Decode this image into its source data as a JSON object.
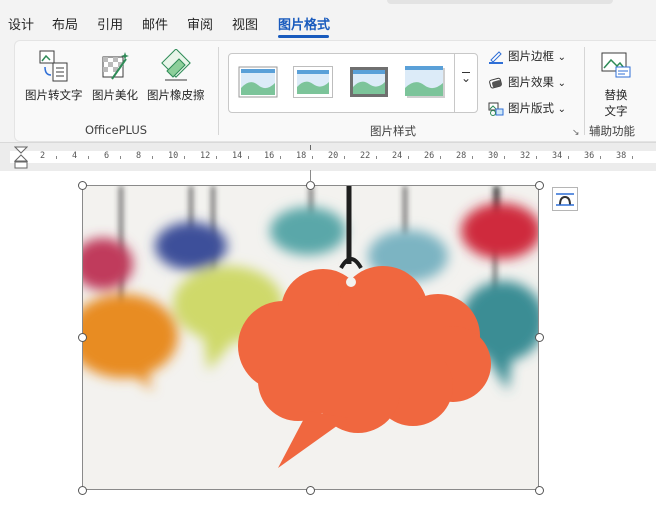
{
  "tabs": [
    {
      "label": "设计"
    },
    {
      "label": "布局"
    },
    {
      "label": "引用"
    },
    {
      "label": "邮件"
    },
    {
      "label": "审阅"
    },
    {
      "label": "视图"
    },
    {
      "label": "图片格式"
    }
  ],
  "ribbon": {
    "officeplus": {
      "group_label": "OfficePLUS",
      "buttons": [
        {
          "label": "图片转文字",
          "icon": "picture-to-text-icon"
        },
        {
          "label": "图片美化",
          "icon": "picture-beautify-icon"
        },
        {
          "label": "图片橡皮擦",
          "icon": "picture-eraser-icon"
        }
      ]
    },
    "picture_styles": {
      "group_label": "图片样式",
      "more_glyph": "⌄",
      "commands": [
        {
          "label": "图片边框",
          "icon": "picture-border-icon",
          "caret": "⌄"
        },
        {
          "label": "图片效果",
          "icon": "picture-effects-icon",
          "caret": "⌄"
        },
        {
          "label": "图片版式",
          "icon": "picture-layout-icon",
          "caret": "⌄"
        }
      ],
      "launcher": "↘"
    },
    "accessibility": {
      "group_label": "辅助功能",
      "button": {
        "label_line1": "替换",
        "label_line2": "文字",
        "icon": "alt-text-icon"
      }
    }
  },
  "ruler": {
    "ticks": [
      "2",
      "4",
      "6",
      "8",
      "10",
      "12",
      "14",
      "16",
      "18",
      "20",
      "22",
      "24",
      "26",
      "28",
      "30",
      "32",
      "34",
      "36",
      "38"
    ]
  },
  "colors": {
    "accent": "#185abd",
    "bubble_main": "#f0673f"
  }
}
